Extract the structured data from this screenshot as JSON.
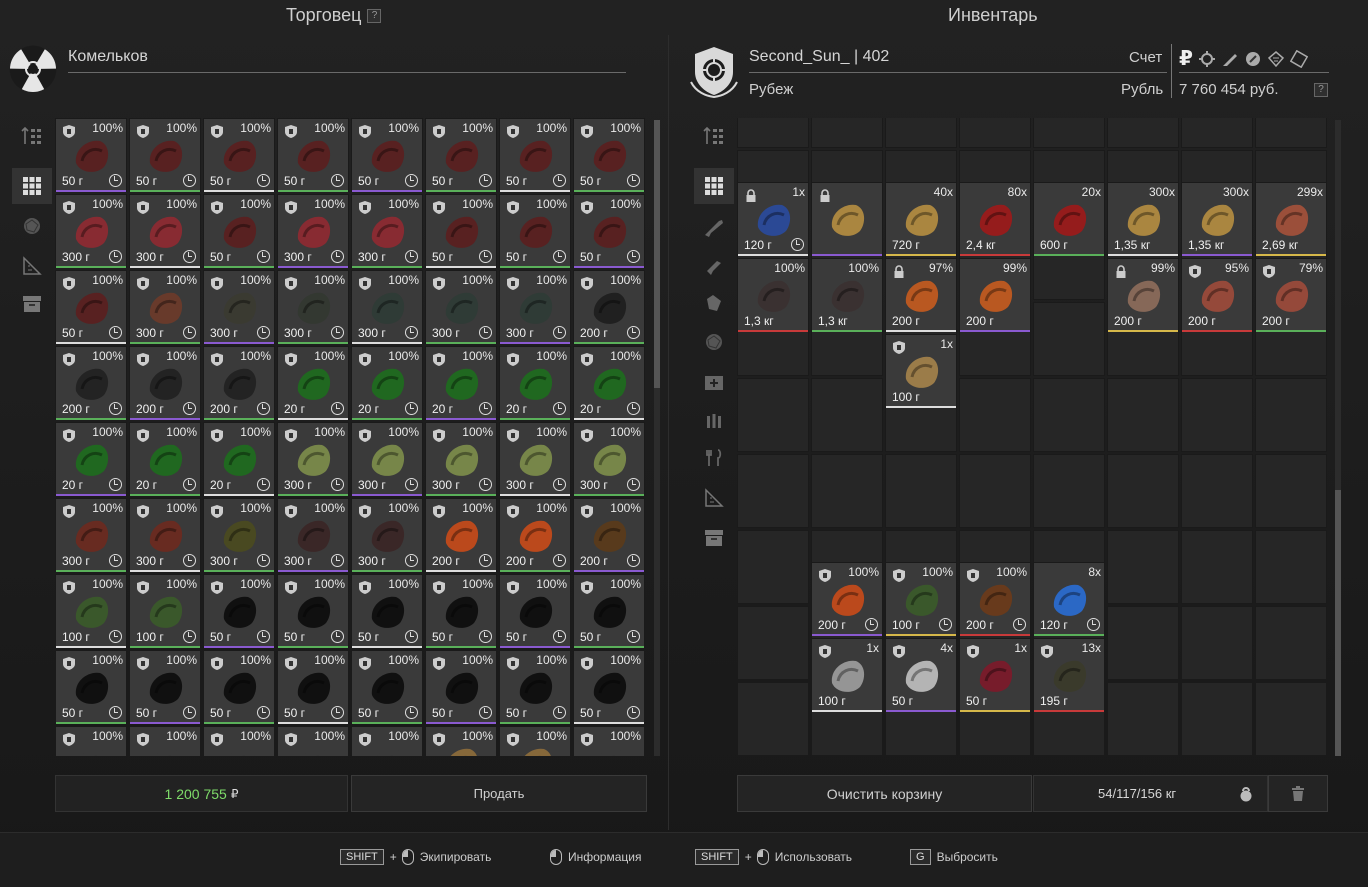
{
  "trader": {
    "title": "Торговец",
    "help": "?",
    "name": "Комельков",
    "total": "1 200 755",
    "currency_symbol": "₽",
    "sell_label": "Продать",
    "rows": [
      [
        {
          "p": "100%",
          "w": "50 г",
          "c": "#5a2020"
        },
        {
          "p": "100%",
          "w": "50 г",
          "c": "#5a2020"
        },
        {
          "p": "100%",
          "w": "50 г",
          "c": "#5a2020"
        },
        {
          "p": "100%",
          "w": "50 г",
          "c": "#5a2020"
        },
        {
          "p": "100%",
          "w": "50 г",
          "c": "#5a2020"
        },
        {
          "p": "100%",
          "w": "50 г",
          "c": "#5a2020"
        },
        {
          "p": "100%",
          "w": "50 г",
          "c": "#5a2020"
        },
        {
          "p": "100%",
          "w": "50 г",
          "c": "#5a2020"
        }
      ],
      [
        {
          "p": "100%",
          "w": "300 г",
          "c": "#8c2a32"
        },
        {
          "p": "100%",
          "w": "300 г",
          "c": "#8c2a32"
        },
        {
          "p": "100%",
          "w": "50 г",
          "c": "#5a2020"
        },
        {
          "p": "100%",
          "w": "300 г",
          "c": "#8c2a32"
        },
        {
          "p": "100%",
          "w": "300 г",
          "c": "#8c2a32"
        },
        {
          "p": "100%",
          "w": "50 г",
          "c": "#5a2020"
        },
        {
          "p": "100%",
          "w": "50 г",
          "c": "#5a2020"
        },
        {
          "p": "100%",
          "w": "50 г",
          "c": "#5a2020"
        }
      ],
      [
        {
          "p": "100%",
          "w": "50 г",
          "c": "#5a2020"
        },
        {
          "p": "100%",
          "w": "300 г",
          "c": "#6a3a2a"
        },
        {
          "p": "100%",
          "w": "300 г",
          "c": "#3a3a30"
        },
        {
          "p": "100%",
          "w": "300 г",
          "c": "#333830"
        },
        {
          "p": "100%",
          "w": "300 г",
          "c": "#2e3b36"
        },
        {
          "p": "100%",
          "w": "300 г",
          "c": "#2e3b36"
        },
        {
          "p": "100%",
          "w": "300 г",
          "c": "#2e3b36"
        },
        {
          "p": "100%",
          "w": "200 г",
          "c": "#1f1f1f"
        }
      ],
      [
        {
          "p": "100%",
          "w": "200 г",
          "c": "#222"
        },
        {
          "p": "100%",
          "w": "200 г",
          "c": "#222"
        },
        {
          "p": "100%",
          "w": "200 г",
          "c": "#222"
        },
        {
          "p": "100%",
          "w": "20 г",
          "c": "#1f6a1f"
        },
        {
          "p": "100%",
          "w": "20 г",
          "c": "#1f6a1f"
        },
        {
          "p": "100%",
          "w": "20 г",
          "c": "#1f6a1f"
        },
        {
          "p": "100%",
          "w": "20 г",
          "c": "#1f6a1f"
        },
        {
          "p": "100%",
          "w": "20 г",
          "c": "#1f6a1f"
        }
      ],
      [
        {
          "p": "100%",
          "w": "20 г",
          "c": "#1f6a1f"
        },
        {
          "p": "100%",
          "w": "20 г",
          "c": "#1f6a1f"
        },
        {
          "p": "100%",
          "w": "20 г",
          "c": "#1f6a1f"
        },
        {
          "p": "100%",
          "w": "300 г",
          "c": "#7a8a4a"
        },
        {
          "p": "100%",
          "w": "300 г",
          "c": "#7a8a4a"
        },
        {
          "p": "100%",
          "w": "300 г",
          "c": "#7a8a4a"
        },
        {
          "p": "100%",
          "w": "300 г",
          "c": "#7a8a4a"
        },
        {
          "p": "100%",
          "w": "300 г",
          "c": "#7a8a4a"
        }
      ],
      [
        {
          "p": "100%",
          "w": "300 г",
          "c": "#6a2a20"
        },
        {
          "p": "100%",
          "w": "300 г",
          "c": "#6a2a20"
        },
        {
          "p": "100%",
          "w": "300 г",
          "c": "#4a4a20"
        },
        {
          "p": "100%",
          "w": "300 г",
          "c": "#3a2626"
        },
        {
          "p": "100%",
          "w": "300 г",
          "c": "#3a2626"
        },
        {
          "p": "100%",
          "w": "200 г",
          "c": "#c24a1a"
        },
        {
          "p": "100%",
          "w": "200 г",
          "c": "#c24a1a"
        },
        {
          "p": "100%",
          "w": "200 г",
          "c": "#5a3a1a"
        }
      ],
      [
        {
          "p": "100%",
          "w": "100 г",
          "c": "#3a5a2a"
        },
        {
          "p": "100%",
          "w": "100 г",
          "c": "#3a5a2a"
        },
        {
          "p": "100%",
          "w": "50 г",
          "c": "#0e0e0e"
        },
        {
          "p": "100%",
          "w": "50 г",
          "c": "#0e0e0e"
        },
        {
          "p": "100%",
          "w": "50 г",
          "c": "#0e0e0e"
        },
        {
          "p": "100%",
          "w": "50 г",
          "c": "#0e0e0e"
        },
        {
          "p": "100%",
          "w": "50 г",
          "c": "#0e0e0e"
        },
        {
          "p": "100%",
          "w": "50 г",
          "c": "#0e0e0e"
        }
      ],
      [
        {
          "p": "100%",
          "w": "50 г",
          "c": "#0e0e0e"
        },
        {
          "p": "100%",
          "w": "50 г",
          "c": "#0e0e0e"
        },
        {
          "p": "100%",
          "w": "50 г",
          "c": "#0e0e0e"
        },
        {
          "p": "100%",
          "w": "50 г",
          "c": "#0e0e0e"
        },
        {
          "p": "100%",
          "w": "50 г",
          "c": "#0e0e0e"
        },
        {
          "p": "100%",
          "w": "50 г",
          "c": "#0e0e0e"
        },
        {
          "p": "100%",
          "w": "50 г",
          "c": "#0e0e0e"
        },
        {
          "p": "100%",
          "w": "50 г",
          "c": "#0e0e0e"
        }
      ],
      [
        {
          "p": "100%",
          "w": "",
          "c": "#3a3a3a"
        },
        {
          "p": "100%",
          "w": "",
          "c": "#3a3a3a"
        },
        {
          "p": "100%",
          "w": "",
          "c": "#3a3a3a"
        },
        {
          "p": "100%",
          "w": "",
          "c": "#3a3a3a"
        },
        {
          "p": "100%",
          "w": "",
          "c": "#3a3a3a"
        },
        {
          "p": "100%",
          "w": "",
          "c": "#8a6a3a"
        },
        {
          "p": "100%",
          "w": "",
          "c": "#8a6a3a"
        },
        {
          "p": "100%",
          "w": "",
          "c": "#3a3a3a"
        }
      ]
    ]
  },
  "inventory": {
    "title": "Инвентарь",
    "player": "Second_Sun_ | 402",
    "location": "Рубеж",
    "account_label": "Счет",
    "currency_label": "Рубль",
    "balance": "7 760 454 руб.",
    "help": "?",
    "clear_label": "Очистить корзину",
    "weight": "54/117/156 кг",
    "items": [
      {
        "col": 0,
        "row": 1,
        "p": "1x",
        "w": "120 г",
        "c": "#2a4a9a",
        "lock": true,
        "clock": true
      },
      {
        "col": 1,
        "row": 1,
        "p": "",
        "w": "",
        "c": "#b08a40",
        "lock": true
      },
      {
        "col": 2,
        "row": 1,
        "p": "40x",
        "w": "720 г",
        "c": "#b08a40"
      },
      {
        "col": 3,
        "row": 1,
        "p": "80x",
        "w": "2,4 кг",
        "c": "#9a1a1a"
      },
      {
        "col": 4,
        "row": 1,
        "p": "20x",
        "w": "600 г",
        "c": "#9a1a1a"
      },
      {
        "col": 5,
        "row": 1,
        "p": "300x",
        "w": "1,35 кг",
        "c": "#b08a40"
      },
      {
        "col": 6,
        "row": 1,
        "p": "300x",
        "w": "1,35 кг",
        "c": "#b08a40"
      },
      {
        "col": 7,
        "row": 1,
        "p": "299x",
        "w": "2,69 кг",
        "c": "#a0503a"
      },
      {
        "col": 0,
        "row": 2,
        "p": "100%",
        "w": "1,3 кг",
        "c": "#3a3030"
      },
      {
        "col": 1,
        "row": 2,
        "p": "100%",
        "w": "1,3 кг",
        "c": "#3a3030"
      },
      {
        "col": 2,
        "row": 2,
        "p": "97%",
        "w": "200 г",
        "c": "#c05a20",
        "lock": true
      },
      {
        "col": 3,
        "row": 2,
        "p": "99%",
        "w": "200 г",
        "c": "#c05a20"
      },
      {
        "col": 5,
        "row": 2,
        "p": "99%",
        "w": "200 г",
        "c": "#8a6a5a",
        "lock": true
      },
      {
        "col": 6,
        "row": 2,
        "p": "95%",
        "w": "200 г",
        "c": "#9a4a3a",
        "shield": true
      },
      {
        "col": 7,
        "row": 2,
        "p": "79%",
        "w": "200 г",
        "c": "#9a4a3a",
        "shield": true
      },
      {
        "col": 2,
        "row": 3,
        "p": "1x",
        "w": "100 г",
        "c": "#a0804a",
        "shield": true
      },
      {
        "col": 1,
        "row": 6,
        "p": "100%",
        "w": "200 г",
        "c": "#c24a1a",
        "shield": true,
        "clock": true
      },
      {
        "col": 2,
        "row": 6,
        "p": "100%",
        "w": "100 г",
        "c": "#3a5a2a",
        "shield": true,
        "clock": true
      },
      {
        "col": 3,
        "row": 6,
        "p": "100%",
        "w": "200 г",
        "c": "#6a3a1a",
        "shield": true,
        "clock": true
      },
      {
        "col": 4,
        "row": 6,
        "p": "8x",
        "w": "120 г",
        "c": "#2a6acc",
        "clock": true
      },
      {
        "col": 1,
        "row": 7,
        "p": "1x",
        "w": "100 г",
        "c": "#9a9a9a",
        "shield": true
      },
      {
        "col": 2,
        "row": 7,
        "p": "4x",
        "w": "50 г",
        "c": "#bbbbbb",
        "shield": true
      },
      {
        "col": 3,
        "row": 7,
        "p": "1x",
        "w": "50 г",
        "c": "#7a1a2a",
        "shield": true
      },
      {
        "col": 4,
        "row": 7,
        "p": "13x",
        "w": "195 г",
        "c": "#3a3a2a",
        "shield": true
      }
    ]
  },
  "footer": {
    "hints": [
      {
        "key": "SHIFT",
        "mouse": true,
        "label": "Экипировать"
      },
      {
        "key": "",
        "mouse": true,
        "label": "Информация"
      },
      {
        "key": "SHIFT",
        "mouse": true,
        "label": "Использовать"
      },
      {
        "key": "G",
        "mouse": false,
        "label": "Выбросить"
      }
    ],
    "plus": "+"
  },
  "colors": {
    "accent_green": "#7fdc6a",
    "bar_purple": "#8a5ad0",
    "bar_green": "#5ab05a",
    "bar_white": "#dddddd",
    "bar_red": "#c83a3a",
    "bar_yellow": "#d6b84a"
  }
}
